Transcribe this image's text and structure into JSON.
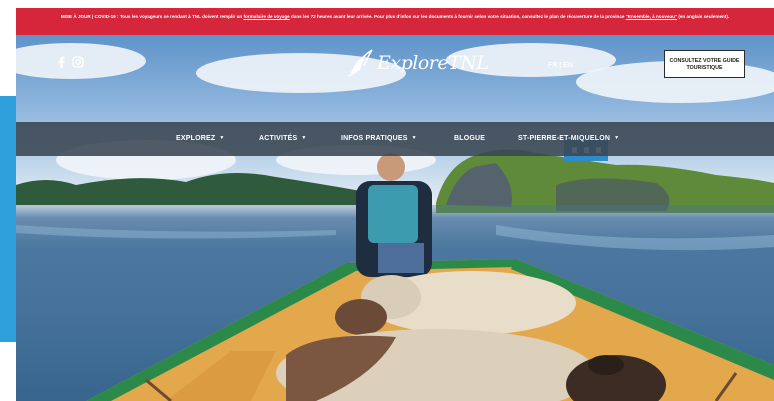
{
  "alert": {
    "prefix": "MISE À JOUR | COVID-19 : Tous les voyageurs se rendant à TNL doivent remplir un",
    "link1": "formulaire de voyage",
    "middle": "dans les 72 heures avant leur arrivée. Pour plus d'infos sur les documents à fournir selon votre situation, consultez le plan de réouverture de la province",
    "link2": "\"Ensemble, à nouveau\"",
    "suffix": "(en anglais seulement)."
  },
  "header": {
    "logo_text": "ExploreTNL",
    "language_label": "FR | EN",
    "guide_button_label": "CONSULTEZ VOTRE GUIDE TOURISTIQUE"
  },
  "nav": {
    "items": [
      {
        "label": "EXPLOREZ",
        "dropdown": true
      },
      {
        "label": "ACTIVITÉS",
        "dropdown": true
      },
      {
        "label": "INFOS PRATIQUES",
        "dropdown": true
      },
      {
        "label": "BLOGUE",
        "dropdown": false
      },
      {
        "label": "ST-PIERRE-ET-MIQUELON",
        "dropdown": true
      }
    ]
  },
  "icons": {
    "social": [
      "facebook-icon",
      "instagram-icon"
    ],
    "logo": "bird-logo-icon",
    "dropdown": "chevron-down-icon"
  },
  "colors": {
    "alert_background": "#d6263b",
    "nav_background": "#3a4652",
    "left_accent": "#2f9fdc",
    "boat_trim": "#2b8a49"
  }
}
